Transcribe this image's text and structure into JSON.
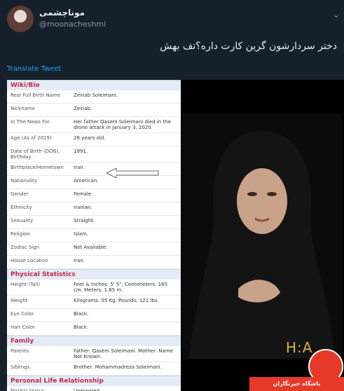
{
  "author": {
    "name": "موناچشمی",
    "handle": "@moonacheshmi"
  },
  "tweet_text": "دختر سردارشون گرین کارت داره؟تف بهش",
  "translate_label": "Translate Tweet",
  "wiki": {
    "sections": [
      {
        "title": "Wiki/Bio",
        "rows": [
          {
            "k": "Real Full Birth Name",
            "v": "Zeinab Soleimani."
          },
          {
            "k": "Nickname",
            "v": "Zeinab."
          },
          {
            "k": "In The News For",
            "v": "Her father Qasem Soleimani died in the drone attack in January 3, 2020."
          },
          {
            "k": "Age (As of 2019)",
            "v": "28 years old."
          },
          {
            "k": "Date of Birth (DOB), Birthday",
            "v": "1991."
          },
          {
            "k": "Birthplace/Hometown",
            "v": "Iran."
          },
          {
            "k": "Nationality",
            "v": "American."
          },
          {
            "k": "Gender",
            "v": "Female."
          },
          {
            "k": "Ethnicity",
            "v": "Iranian."
          },
          {
            "k": "Sexuality",
            "v": "Straight."
          },
          {
            "k": "Religion",
            "v": "Islam."
          },
          {
            "k": "Zodiac Sign",
            "v": "Not Available."
          },
          {
            "k": "House Location",
            "v": "Iran."
          }
        ]
      },
      {
        "title": "Physical Statistics",
        "rows": [
          {
            "k": "Height (Tall)",
            "v": "Feet & Inches: 5' 5\". Centimeters: 165 cm. Meters: 1.65 m."
          },
          {
            "k": "Weight",
            "v": "Kilograms: 55 Kg. Pounds: 121 lbs."
          },
          {
            "k": "Eye Color",
            "v": "Black."
          },
          {
            "k": "Hair Color",
            "v": "Black."
          }
        ]
      },
      {
        "title": "Family",
        "rows": [
          {
            "k": "Parents",
            "v": "Father: Qasem Soleimani. Mother: Name Not Known."
          },
          {
            "k": "Siblings",
            "v": "Brother: Mohammadreza Soleimani."
          }
        ]
      },
      {
        "title": "Personal Life Relationship",
        "rows": [
          {
            "k": "Marital Status",
            "v": "Unmarried."
          }
        ]
      }
    ]
  },
  "watermark": "H:A",
  "brand_text": "باشگاه خبرنگاران"
}
